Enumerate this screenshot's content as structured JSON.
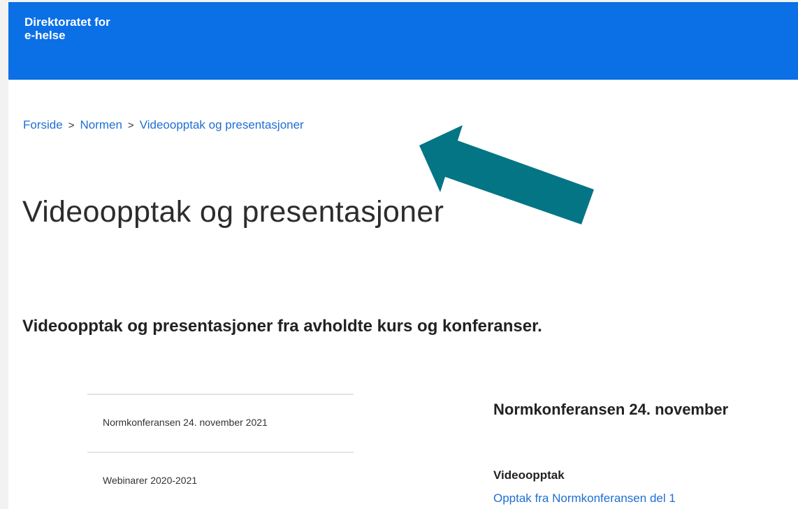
{
  "header": {
    "logo_line1": "Direktoratet for",
    "logo_line2": "e-helse",
    "color": "#0b6fe6"
  },
  "breadcrumb": {
    "items": [
      "Forside",
      "Normen",
      "Videoopptak og presentasjoner"
    ],
    "separator": ">"
  },
  "page": {
    "title": "Videoopptak og presentasjoner",
    "lead": "Videoopptak og presentasjoner fra avholdte kurs og konferanser."
  },
  "sidenav": {
    "items": [
      "Normkonferansen 24. november 2021",
      "Webinarer 2020-2021"
    ]
  },
  "content": {
    "section_title": "Normkonferansen 24. november",
    "subheading": "Videoopptak",
    "link": "Opptak fra Normkonferansen del 1"
  },
  "annotation": {
    "arrow_color": "#037585",
    "icon": "arrow-pointer-icon"
  },
  "colors": {
    "link": "#1f6fd2",
    "text": "#2c2c2c"
  }
}
